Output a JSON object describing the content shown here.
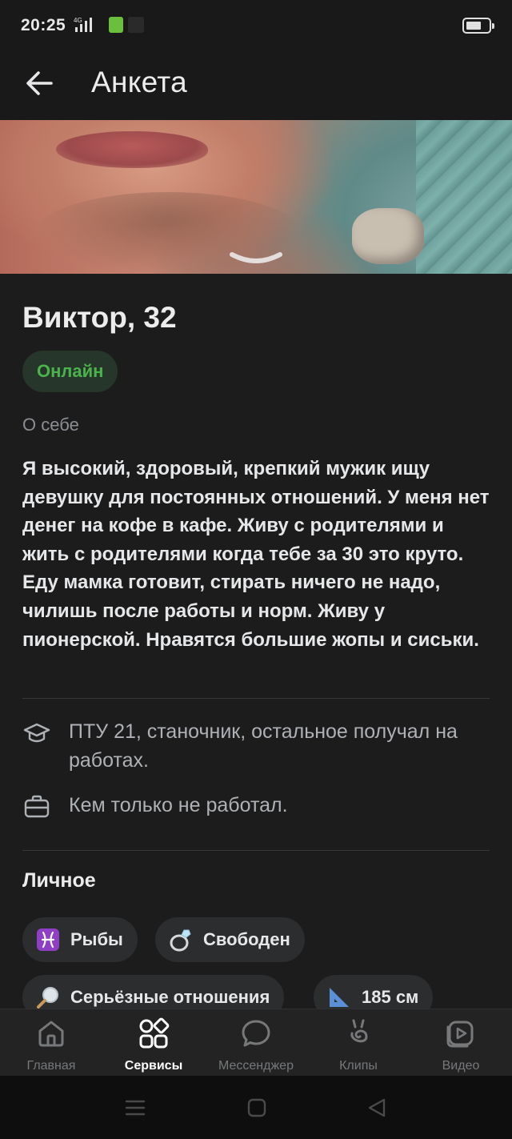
{
  "status_bar": {
    "time": "20:25",
    "network": "4G"
  },
  "header": {
    "title": "Анкета",
    "back_icon": "arrow-left-icon"
  },
  "profile": {
    "name_age": "Виктор, 32",
    "status": "Онлайн",
    "status_color": "#4bb34b",
    "about_label": "О себе",
    "about_text": "Я высокий, здоровый, крепкий мужик ищу девушку для постоянных отношений. У меня нет денег на кофе в кафе. Живу с родителями и жить с родителями когда тебе за 30 это круто. Еду мамка готовит, стирать ничего не надо, чилишь после работы и норм. Живу у пионерской. Нравятся большие жопы и сиськи.",
    "education": {
      "icon": "graduation-cap-icon",
      "text": "ПТУ 21, станочник, остальное получал на работах."
    },
    "work": {
      "icon": "briefcase-icon",
      "text": "Кем только не работал."
    }
  },
  "personal": {
    "title": "Личное",
    "chips": [
      {
        "label": "Рыбы",
        "icon": "pisces-icon"
      },
      {
        "label": "Свободен",
        "icon": "ring-icon"
      },
      {
        "label": "Серьёзные отношения",
        "icon": "magnifier-icon"
      },
      {
        "label": "185 см",
        "icon": "ruler-triangle-icon"
      }
    ]
  },
  "tab_bar": {
    "active": "Сервисы",
    "tabs": [
      {
        "label": "Главная",
        "icon": "home-icon"
      },
      {
        "label": "Сервисы",
        "icon": "services-grid-icon"
      },
      {
        "label": "Мессенджер",
        "icon": "chat-bubble-icon"
      },
      {
        "label": "Клипы",
        "icon": "clips-icon"
      },
      {
        "label": "Видео",
        "icon": "video-icon"
      }
    ]
  },
  "colors": {
    "background": "#1c1c1d",
    "accent_green": "#4bb34b",
    "chip_bg": "#2c2d2e"
  }
}
